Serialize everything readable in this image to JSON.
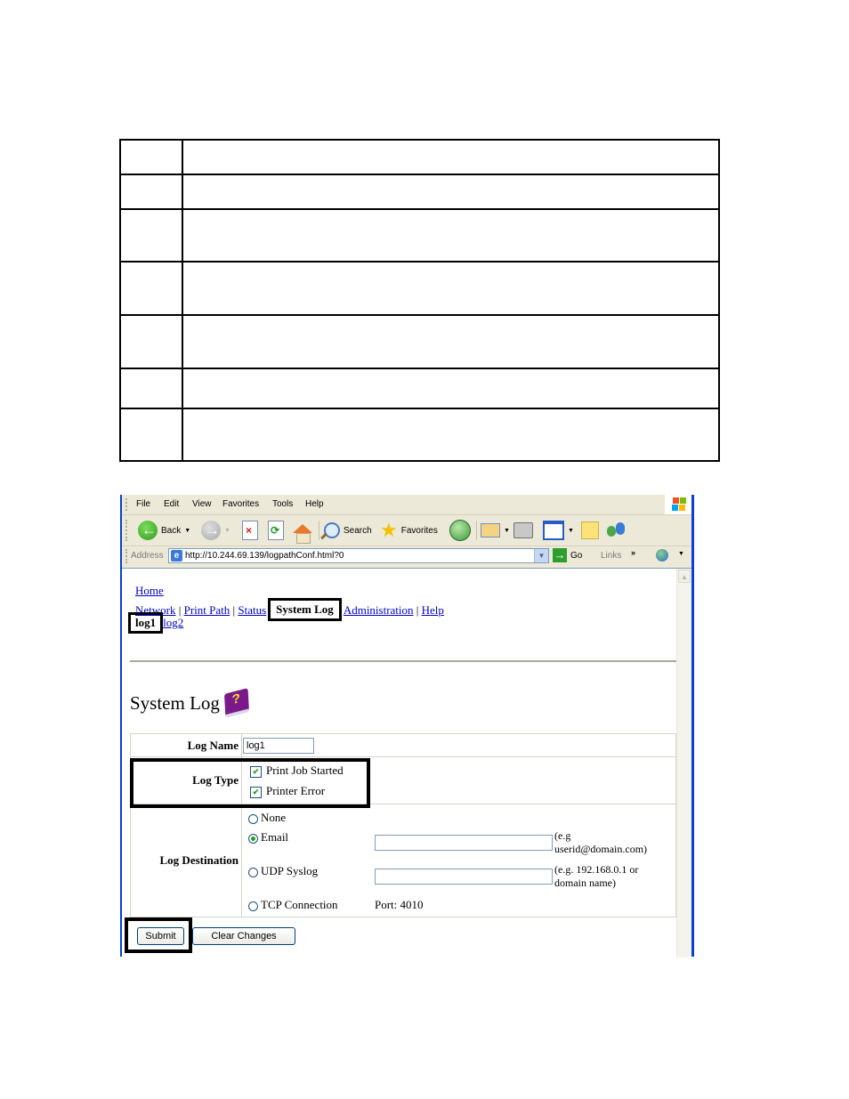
{
  "doc_table": {
    "rows": 7,
    "cells": [
      [
        "",
        ""
      ],
      [
        "",
        ""
      ],
      [
        "",
        ""
      ],
      [
        "",
        ""
      ],
      [
        "",
        ""
      ],
      [
        "",
        ""
      ],
      [
        "",
        ""
      ]
    ]
  },
  "browser": {
    "menu": [
      "File",
      "Edit",
      "View",
      "Favorites",
      "Tools",
      "Help"
    ],
    "menu_accel": [
      "F",
      "E",
      "V",
      "a",
      "T",
      "H"
    ],
    "toolbar": {
      "back": "Back",
      "search": "Search",
      "favorites": "Favorites"
    },
    "address": {
      "label": "Address",
      "url": "http://10.244.69.139/logpathConf.html?0",
      "go": "Go",
      "links": "Links",
      "links_chevron": "»"
    }
  },
  "page": {
    "home": "Home",
    "nav": [
      {
        "label": "Network",
        "active": false
      },
      {
        "label": "Print Path",
        "active": false
      },
      {
        "label": "Status",
        "active": false
      },
      {
        "label": "System Log",
        "active": true
      },
      {
        "label": "Administration",
        "active": false
      },
      {
        "label": "Help",
        "active": false
      }
    ],
    "subnav": [
      {
        "label": "log1",
        "active": true
      },
      {
        "label": "log2",
        "active": false
      }
    ],
    "title": "System Log",
    "help_icon": "book-question-icon",
    "form": {
      "log_name_label": "Log Name",
      "log_name_value": "log1",
      "log_type_label": "Log Type",
      "log_types": [
        {
          "label": "Print Job Started",
          "checked": true
        },
        {
          "label": "Printer Error",
          "checked": true
        }
      ],
      "log_destination_label": "Log Destination",
      "destinations": {
        "none": {
          "label": "None",
          "selected": false
        },
        "email": {
          "label": "Email",
          "selected": true,
          "value": "",
          "hint": "(e.g userid@domain.com)"
        },
        "udp": {
          "label": "UDP Syslog",
          "selected": false,
          "value": "",
          "hint": "(e.g. 192.168.0.1 or domain name)"
        },
        "tcp": {
          "label": "TCP Connection",
          "selected": false,
          "port_text": "Port: 4010"
        }
      }
    },
    "submit": "Submit",
    "clear": "Clear Changes"
  }
}
